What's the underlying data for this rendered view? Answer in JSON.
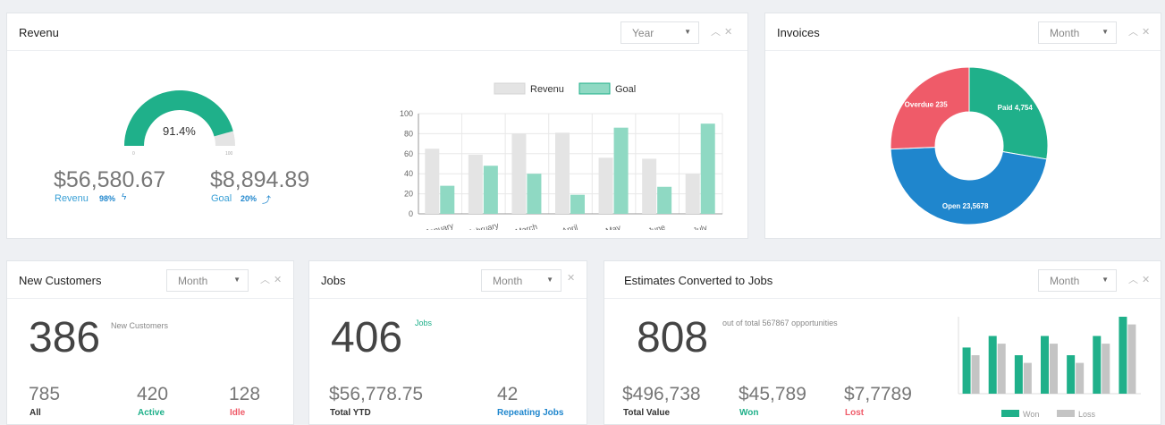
{
  "revenue": {
    "title": "Revenu",
    "period": "Year",
    "gauge": {
      "value": 91.4,
      "label": "91.4%",
      "min_label": "0",
      "max_label": "100"
    },
    "amount": "$56,580.67",
    "amount_label": "Revenu",
    "amount_badge": "98%",
    "goal": "$8,894.89",
    "goal_label": "Goal",
    "goal_badge": "20%"
  },
  "invoices": {
    "title": "Invoices",
    "period": "Month"
  },
  "new_customers": {
    "title": "New Customers",
    "period": "Month",
    "value": "386",
    "caption": "New Customers",
    "stats": [
      {
        "value": "785",
        "label": "All"
      },
      {
        "value": "420",
        "label": "Active"
      },
      {
        "value": "128",
        "label": "Idle"
      }
    ]
  },
  "jobs": {
    "title": "Jobs",
    "period": "Month",
    "value": "406",
    "caption": "Jobs",
    "stats": [
      {
        "value": "$56,778.75",
        "label": "Total YTD"
      },
      {
        "value": "42",
        "label": "Repeating Jobs"
      }
    ]
  },
  "estimates": {
    "title": "Estimates Converted to Jobs",
    "period": "Month",
    "value": "808",
    "caption": "out of total 567867 opportunities",
    "stats": [
      {
        "value": "$496,738",
        "label": "Total Value"
      },
      {
        "value": "$45,789",
        "label": "Won"
      },
      {
        "value": "$7,7789",
        "label": "Lost"
      }
    ]
  },
  "colors": {
    "green": "#1fb08a",
    "green_light": "#8fd9c3",
    "gray_light": "#e4e4e4",
    "red": "#ef5b69",
    "blue": "#1f86cd",
    "gray_bar": "#c4c4c4"
  },
  "chart_data": [
    {
      "type": "bar",
      "categories": [
        "January",
        "February",
        "March",
        "April",
        "May",
        "June",
        "July"
      ],
      "series": [
        {
          "name": "Revenu",
          "values": [
            65,
            59,
            80,
            81,
            56,
            55,
            40
          ]
        },
        {
          "name": "Goal",
          "values": [
            28,
            48,
            40,
            19,
            86,
            27,
            90
          ]
        }
      ],
      "ylim": [
        0,
        100
      ],
      "yticks": [
        "0",
        "20",
        "40",
        "60",
        "80",
        "100"
      ],
      "legend": "top"
    },
    {
      "type": "pie",
      "donut": true,
      "slices": [
        {
          "label": "Paid",
          "value": 4754,
          "display": "Paid 4,754"
        },
        {
          "label": "Open",
          "value": 8000,
          "display": "Open 23,5678"
        },
        {
          "label": "Overdue",
          "value": 4400,
          "display": "Overdue 235"
        }
      ]
    },
    {
      "type": "bar",
      "categories": [
        "",
        "",
        "",
        "",
        "",
        "",
        ""
      ],
      "series": [
        {
          "name": "Won",
          "values": [
            60,
            75,
            50,
            75,
            50,
            75,
            100
          ]
        },
        {
          "name": "Loss",
          "values": [
            50,
            65,
            40,
            65,
            40,
            65,
            90
          ]
        }
      ],
      "ylim": [
        0,
        100
      ],
      "legend": "bottom"
    }
  ]
}
